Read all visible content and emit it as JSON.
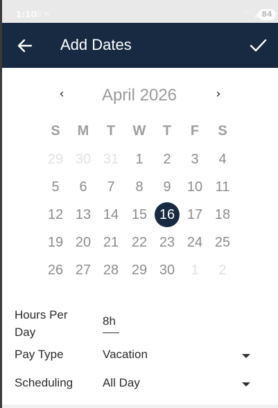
{
  "status_bar": {
    "time": "1:10",
    "icons_left": "◎ ∞",
    "signal": "◠ ◢",
    "battery": "84"
  },
  "app_bar": {
    "title": "Add Dates",
    "back_icon": "arrow-left-icon",
    "confirm_icon": "check-icon",
    "background_color": "#172a41"
  },
  "calendar": {
    "prev_label": "‹",
    "next_label": "›",
    "month_label": "April 2026",
    "weekdays": [
      "S",
      "M",
      "T",
      "W",
      "T",
      "F",
      "S"
    ],
    "weeks": [
      [
        {
          "d": "29",
          "out": true
        },
        {
          "d": "30",
          "out": true
        },
        {
          "d": "31",
          "out": true
        },
        {
          "d": "1"
        },
        {
          "d": "2"
        },
        {
          "d": "3"
        },
        {
          "d": "4"
        }
      ],
      [
        {
          "d": "5"
        },
        {
          "d": "6"
        },
        {
          "d": "7"
        },
        {
          "d": "8"
        },
        {
          "d": "9"
        },
        {
          "d": "10"
        },
        {
          "d": "11"
        }
      ],
      [
        {
          "d": "12"
        },
        {
          "d": "13"
        },
        {
          "d": "14"
        },
        {
          "d": "15"
        },
        {
          "d": "16",
          "selected": true
        },
        {
          "d": "17"
        },
        {
          "d": "18"
        }
      ],
      [
        {
          "d": "19"
        },
        {
          "d": "20"
        },
        {
          "d": "21"
        },
        {
          "d": "22"
        },
        {
          "d": "23"
        },
        {
          "d": "24"
        },
        {
          "d": "25"
        }
      ],
      [
        {
          "d": "26"
        },
        {
          "d": "27"
        },
        {
          "d": "28"
        },
        {
          "d": "29"
        },
        {
          "d": "30"
        },
        {
          "d": "1",
          "out": true
        },
        {
          "d": "2",
          "out": true
        }
      ]
    ],
    "selected_color": "#172a41"
  },
  "form": {
    "hours_label": "Hours Per Day",
    "hours_value": "8h",
    "pay_type_label": "Pay Type",
    "pay_type_value": "Vacation",
    "scheduling_label": "Scheduling",
    "scheduling_value": "All Day"
  }
}
